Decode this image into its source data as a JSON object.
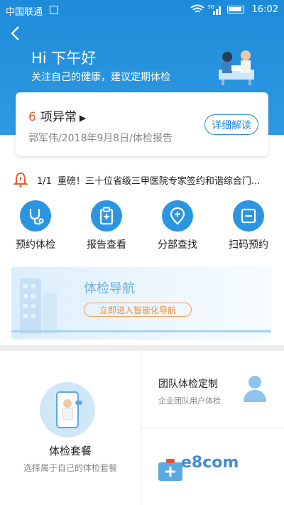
{
  "status_bar": {
    "carrier": "中国联通",
    "time": "16:02",
    "network": "3G"
  },
  "header": {
    "greeting": "Hi 下午好",
    "subtitle": "关注自己的健康，建议定期体检"
  },
  "report_card": {
    "abnormal_count": "6",
    "abnormal_label": "项异常",
    "report_line": "郭军伟/2018年9月8日/体检报告",
    "detail_button": "详细解读"
  },
  "notice": {
    "index": "1/1",
    "text": "重磅！三十位省级三甲医院专家签约和谐综合门..."
  },
  "quick_actions": [
    {
      "label": "预约体检",
      "icon": "stethoscope-icon"
    },
    {
      "label": "报告查看",
      "icon": "report-icon"
    },
    {
      "label": "分部查找",
      "icon": "location-icon"
    },
    {
      "label": "扫码预约",
      "icon": "scan-icon"
    }
  ],
  "banner": {
    "title": "体检导航",
    "button": "立即进入智能化导航"
  },
  "package": {
    "title": "体检套餐",
    "subtitle": "选择属于自己的体检套餐"
  },
  "team": {
    "title": "团队体检定制",
    "subtitle": "企业团队用户体检"
  },
  "watermark": "e8com",
  "colors": {
    "primary": "#1f8ad5",
    "accent_orange": "#e65b2a",
    "banner_button": "#f08a33"
  }
}
